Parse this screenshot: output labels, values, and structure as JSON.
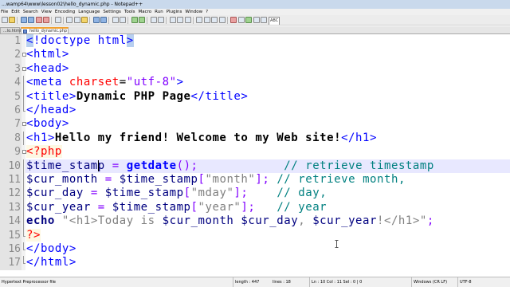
{
  "window": {
    "title": "...wamp64\\www\\lesson02\\hello_dynamic.php - Notepad++"
  },
  "menubar": {
    "items": [
      "File",
      "Edit",
      "Search",
      "View",
      "Encoding",
      "Language",
      "Settings",
      "Tools",
      "Macro",
      "Run",
      "Plugins",
      "Window",
      "?"
    ]
  },
  "toolbar": {
    "buttons": [
      "new-file-icon",
      "open-file-icon",
      "save-icon",
      "save-all-icon",
      "close-icon",
      "close-all-icon",
      "print-icon",
      "cut-icon",
      "copy-icon",
      "paste-icon",
      "undo-icon",
      "redo-icon",
      "find-icon",
      "replace-icon",
      "zoom-in-icon",
      "zoom-out-icon",
      "sync-vertical-icon",
      "sync-horizontal-icon",
      "word-wrap-icon",
      "show-all-chars-icon",
      "indent-guide-icon",
      "doc-map-icon",
      "function-list-icon",
      "folder-workspace-icon",
      "monitoring-icon",
      "record-macro-icon",
      "stop-macro-icon",
      "play-macro-icon",
      "run-macro-icon",
      "save-macro-icon"
    ],
    "spellcheck_label": "ABC"
  },
  "tabs": [
    {
      "label": "...lo.html"
    },
    {
      "label": "hello_dynamic.php",
      "active": true
    }
  ],
  "editor": {
    "current_line": 10,
    "lines": [
      {
        "n": "1",
        "tokens": [
          [
            "brk",
            "<"
          ],
          [
            "tag",
            "!doctype html"
          ],
          [
            "brk",
            ">"
          ]
        ]
      },
      {
        "n": "2",
        "tokens": [
          [
            "tag",
            "<html>"
          ]
        ]
      },
      {
        "n": "3",
        "tokens": [
          [
            "tag",
            "<head>"
          ]
        ]
      },
      {
        "n": "4",
        "tokens": [
          [
            "tag",
            "<meta "
          ],
          [
            "attr",
            "charset"
          ],
          [
            "plain",
            "="
          ],
          [
            "str",
            "\"utf-8\""
          ],
          [
            "tag",
            ">"
          ]
        ]
      },
      {
        "n": "5",
        "tokens": [
          [
            "tag",
            "<title>"
          ],
          [
            "txt",
            "Dynamic PHP Page"
          ],
          [
            "tag",
            "</title>"
          ]
        ]
      },
      {
        "n": "6",
        "tokens": [
          [
            "tag",
            "</head>"
          ]
        ]
      },
      {
        "n": "7",
        "tokens": [
          [
            "tag",
            "<body>"
          ]
        ]
      },
      {
        "n": "8",
        "tokens": [
          [
            "tag",
            "<h1>"
          ],
          [
            "txt",
            "Hello my friend! Welcome to my Web site!"
          ],
          [
            "tag",
            "</h1>"
          ]
        ]
      },
      {
        "n": "9",
        "tokens": [
          [
            "php",
            "<?php"
          ]
        ]
      },
      {
        "n": "10",
        "tokens": [
          [
            "var",
            "$time_stamp"
          ],
          [
            "plain",
            " "
          ],
          [
            "op",
            "="
          ],
          [
            "plain",
            " "
          ],
          [
            "fn",
            "getdate"
          ],
          [
            "op",
            "();"
          ],
          [
            "plain",
            "            "
          ],
          [
            "cmt",
            "// retrieve timestamp"
          ]
        ]
      },
      {
        "n": "11",
        "tokens": [
          [
            "var",
            "$cur_month"
          ],
          [
            "plain",
            " "
          ],
          [
            "op",
            "="
          ],
          [
            "plain",
            " "
          ],
          [
            "var",
            "$time_stamp"
          ],
          [
            "op",
            "["
          ],
          [
            "sstr",
            "\"month\""
          ],
          [
            "op",
            "];"
          ],
          [
            "plain",
            " "
          ],
          [
            "cmt",
            "// retrieve month,"
          ]
        ]
      },
      {
        "n": "12",
        "tokens": [
          [
            "var",
            "$cur_day"
          ],
          [
            "plain",
            " "
          ],
          [
            "op",
            "="
          ],
          [
            "plain",
            " "
          ],
          [
            "var",
            "$time_stamp"
          ],
          [
            "op",
            "["
          ],
          [
            "sstr",
            "\"mday\""
          ],
          [
            "op",
            "];"
          ],
          [
            "plain",
            "    "
          ],
          [
            "cmt",
            "// day,"
          ]
        ]
      },
      {
        "n": "13",
        "tokens": [
          [
            "var",
            "$cur_year"
          ],
          [
            "plain",
            " "
          ],
          [
            "op",
            "="
          ],
          [
            "plain",
            " "
          ],
          [
            "var",
            "$time_stamp"
          ],
          [
            "op",
            "["
          ],
          [
            "sstr",
            "\"year\""
          ],
          [
            "op",
            "];"
          ],
          [
            "plain",
            "   "
          ],
          [
            "cmt",
            "// year"
          ]
        ]
      },
      {
        "n": "14",
        "tokens": [
          [
            "kw",
            "echo"
          ],
          [
            "plain",
            " "
          ],
          [
            "sstr",
            "\"<h1>Today is "
          ],
          [
            "var",
            "$cur_month $cur_day"
          ],
          [
            "sstr",
            ", "
          ],
          [
            "var",
            "$cur_year"
          ],
          [
            "sstr",
            "!</h1>\""
          ],
          [
            "op",
            ";"
          ]
        ]
      },
      {
        "n": "15",
        "tokens": [
          [
            "php",
            "?>"
          ]
        ]
      },
      {
        "n": "16",
        "tokens": [
          [
            "tag",
            "</body>"
          ]
        ]
      },
      {
        "n": "17",
        "tokens": [
          [
            "tag",
            "</html>"
          ]
        ]
      }
    ]
  },
  "statusbar": {
    "file_type": "Hypertext Preprocessor file",
    "length": "length : 447",
    "lines": "lines : 18",
    "position": "Ln : 10    Col : 11    Sel : 0 | 0",
    "eol": "Windows (CR LF)",
    "encoding": "UTF-8"
  }
}
